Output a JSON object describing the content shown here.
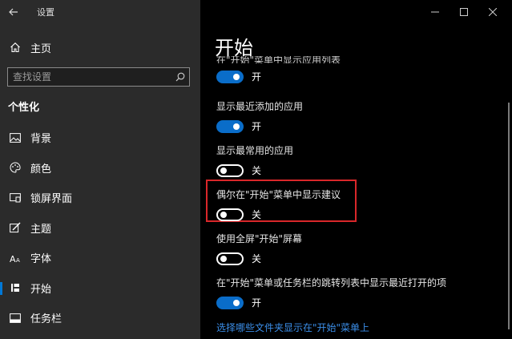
{
  "window": {
    "title": "设置"
  },
  "sidebar": {
    "home_label": "主页",
    "search": {
      "placeholder": "查找设置"
    },
    "section_title": "个性化",
    "items": [
      {
        "label": "背景",
        "icon": "picture-icon"
      },
      {
        "label": "颜色",
        "icon": "palette-icon"
      },
      {
        "label": "锁屏界面",
        "icon": "lock-screen-icon"
      },
      {
        "label": "主题",
        "icon": "theme-brush-icon"
      },
      {
        "label": "字体",
        "icon": "font-icon"
      },
      {
        "label": "开始",
        "icon": "start-icon",
        "active": true
      },
      {
        "label": "任务栏",
        "icon": "taskbar-icon"
      }
    ]
  },
  "content": {
    "page_title": "开始",
    "clipped_label": "在\"开始\"菜单中显示应用列表",
    "settings": [
      {
        "state": "on",
        "state_label": "开"
      },
      {
        "label": "显示最近添加的应用",
        "state": "on",
        "state_label": "开"
      },
      {
        "label": "显示最常用的应用",
        "state": "off",
        "state_label": "关"
      },
      {
        "label": "偶尔在\"开始\"菜单中显示建议",
        "state": "off",
        "state_label": "关",
        "highlighted": true
      },
      {
        "label": "使用全屏\"开始\"屏幕",
        "state": "off",
        "state_label": "关"
      },
      {
        "label": "在\"开始\"菜单或任务栏的跳转列表中显示最近打开的项",
        "state": "on",
        "state_label": "开"
      }
    ],
    "link_text": "选择哪些文件夹显示在\"开始\"菜单上"
  },
  "colors": {
    "accent": "#0a6dc9",
    "highlight_border": "#d9272a",
    "link": "#3b8ee8",
    "sidebar_bg": "#2b2b2b",
    "content_bg": "#000000"
  }
}
